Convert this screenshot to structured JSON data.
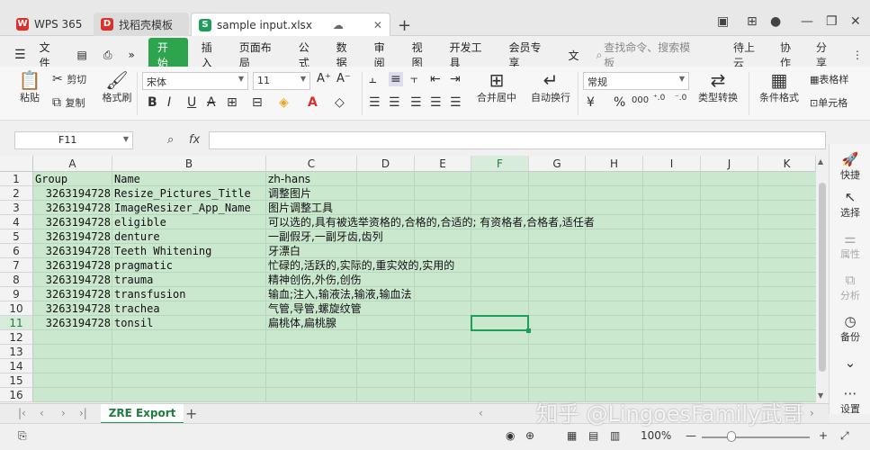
{
  "titlebar": {
    "tabs": [
      {
        "label": "WPS 365",
        "icon": "wps-logo-icon"
      },
      {
        "label": "找稻壳模板",
        "icon": "docer-icon"
      },
      {
        "label": "sample input.xlsx",
        "icon": "spreadsheet-icon"
      }
    ]
  },
  "menu": {
    "items": [
      "文件",
      "开始",
      "插入",
      "页面布局",
      "公式",
      "数据",
      "审阅",
      "视图",
      "开发工具",
      "会员专享",
      "文"
    ],
    "search_placeholder": "查找命令、搜索模板",
    "pending_upload": "待上云",
    "collaborate": "协作",
    "share": "分享"
  },
  "ribbon": {
    "paste": "粘贴",
    "cut": "剪切",
    "copy": "复制",
    "format_painter": "格式刷",
    "font_name": "宋体",
    "font_size": "11",
    "merge_center": "合并居中",
    "wrap_text": "自动换行",
    "number_format": "常规",
    "type_convert": "类型转换",
    "conditional_format": "条件格式",
    "table_style": "表格样",
    "cell": "单元格",
    "bold": "B",
    "italic": "I",
    "underline": "U",
    "font_color": "A",
    "currency": "¥",
    "percent": "%",
    "thousands": "000"
  },
  "formula_bar": {
    "name_box": "F11",
    "fx": "fx",
    "formula": ""
  },
  "grid": {
    "columns": [
      "A",
      "B",
      "C",
      "D",
      "E",
      "F",
      "G",
      "H",
      "I",
      "J",
      "K"
    ],
    "row_numbers": [
      "1",
      "2",
      "3",
      "4",
      "5",
      "6",
      "7",
      "8",
      "9",
      "10",
      "11",
      "12",
      "13",
      "14",
      "15",
      "16"
    ],
    "selected_cell": "F11",
    "rows": [
      [
        "Group",
        "Name",
        "zh-hans"
      ],
      [
        "3263194728",
        "Resize_Pictures_Title",
        "调整图片"
      ],
      [
        "3263194728",
        "ImageResizer_App_Name",
        "图片调整工具"
      ],
      [
        "3263194728",
        "eligible",
        "可以选的,具有被选举资格的,合格的,合适的; 有资格者,合格者,适任者"
      ],
      [
        "3263194728",
        "denture",
        "一副假牙,一副牙齿,齿列"
      ],
      [
        "3263194728",
        "Teeth Whitening",
        "牙漂白"
      ],
      [
        "3263194728",
        "pragmatic",
        "忙碌的,活跃的,实际的,重实效的,实用的"
      ],
      [
        "3263194728",
        "trauma",
        "精神创伤,外伤,创伤"
      ],
      [
        "3263194728",
        "transfusion",
        "输血;注入,输液法,输液,输血法"
      ],
      [
        "3263194728",
        "trachea",
        "气管,导管,螺旋纹管"
      ],
      [
        "3263194728",
        "tonsil",
        "扁桃体,扁桃腺"
      ]
    ]
  },
  "sheets": {
    "active": "ZRE Export"
  },
  "sidebar": {
    "items": [
      "快捷",
      "选择",
      "属性",
      "分析",
      "备份",
      "设置"
    ]
  },
  "status": {
    "zoom": "100%"
  },
  "watermark": "知乎 @LingoesFamily武哥"
}
